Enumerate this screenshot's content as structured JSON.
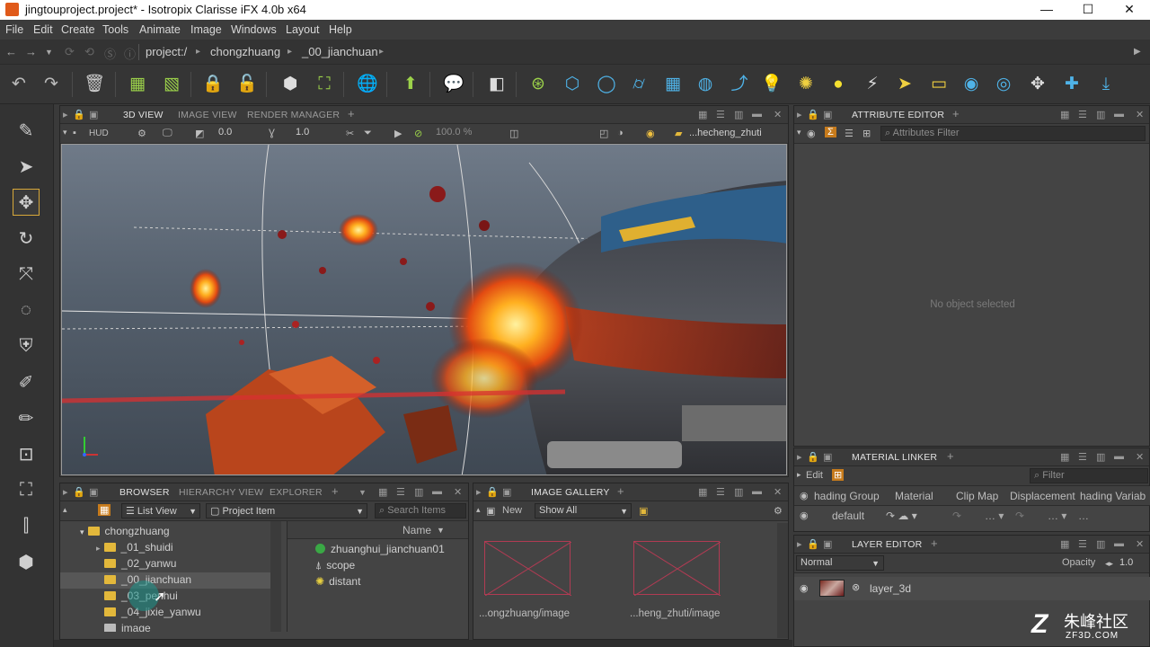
{
  "window": {
    "title": "jingtouproject.project* - Isotropix Clarisse iFX 4.0b x64",
    "minimize_glyph": "—",
    "maximize_glyph": "☐",
    "close_glyph": "✕"
  },
  "menu": [
    "File",
    "Edit",
    "Create",
    "Tools",
    "Animate",
    "Image",
    "Windows",
    "Layout",
    "Help"
  ],
  "nav": {
    "back_glyph": "←",
    "forward_glyph": "→",
    "breadcrumb": [
      "project:/",
      "chongzhuang",
      "_00_jianchuan"
    ],
    "crumb_sep": "▸"
  },
  "viewport_panel": {
    "tabs": [
      "3D VIEW",
      "IMAGE VIEW",
      "RENDER MANAGER"
    ],
    "add_tab": "+",
    "hud_label": "HUD",
    "value_a": "0.0",
    "value_b": "1.0",
    "zoom": "100.0 %",
    "camera_context": "...hecheng_zhuti"
  },
  "attribute_editor": {
    "tab": "ATTRIBUTE EDITOR",
    "filter_placeholder": "Attributes Filter",
    "empty_message": "No object selected"
  },
  "material_linker": {
    "tab": "MATERIAL LINKER",
    "edit_label": "Edit",
    "filter_placeholder": "Filter",
    "columns": [
      "hading Group",
      "Material",
      "Clip Map",
      "Displacement",
      "hading Variab"
    ],
    "row": {
      "name": "default"
    }
  },
  "layer_editor": {
    "tab": "LAYER EDITOR",
    "blend_mode": "Normal",
    "opacity_label": "Opacity",
    "opacity_value": "1.0",
    "layer_name": "layer_3d"
  },
  "browser": {
    "tabs": [
      "BROWSER",
      "HIERARCHY VIEW",
      "EXPLORER"
    ],
    "view_mode": "List View",
    "item_type": "Project Item",
    "search_placeholder": "Search Items",
    "name_column": "Name",
    "tree_root": "chongzhuang",
    "tree_items": [
      "_01_shuidi",
      "_02_yanwu",
      "_00_jianchuan",
      "_03_penhui",
      "_04_jixie_yanwu",
      "image"
    ],
    "items": [
      "zhuanghui_jianchuan01",
      "scope",
      "distant"
    ]
  },
  "image_gallery": {
    "tab": "IMAGE GALLERY",
    "new_label": "New",
    "show_filter": "Show All",
    "images": [
      "...ongzhuang/image",
      "...heng_zhuti/image"
    ]
  },
  "watermark": {
    "line1": "朱峰社区",
    "line2": "ZF3D.COM"
  },
  "colors": {
    "accent": "#e3b83b",
    "selection": "#575757",
    "thumb_frame": "#b13b53"
  }
}
